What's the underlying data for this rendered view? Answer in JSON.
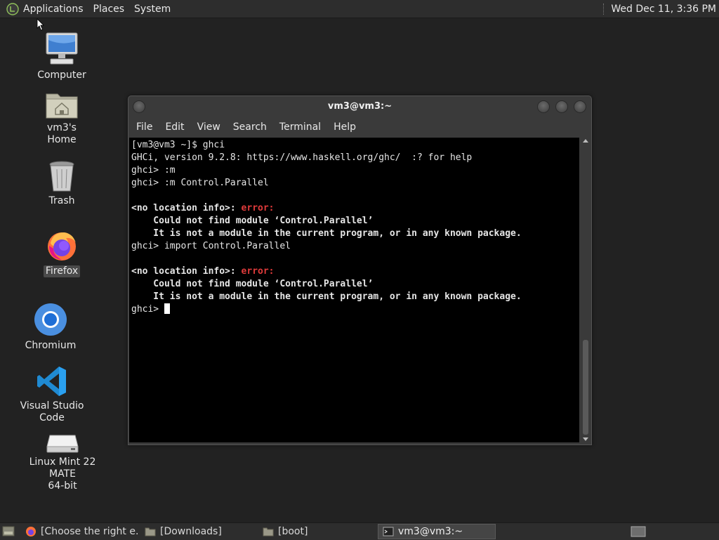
{
  "top_panel": {
    "menus": [
      "Applications",
      "Places",
      "System"
    ],
    "clock": "Wed Dec 11,  3:36 PM"
  },
  "desktop_icons": [
    {
      "label": "Computer",
      "icon": "computer-icon"
    },
    {
      "label": "vm3's Home",
      "icon": "home-folder-icon"
    },
    {
      "label": "Trash",
      "icon": "trash-icon"
    },
    {
      "label": "Firefox",
      "icon": "firefox-icon"
    },
    {
      "label": "Chromium",
      "icon": "chromium-icon"
    },
    {
      "label": "Visual Studio Code",
      "icon": "vscode-icon"
    },
    {
      "label": "Linux Mint 22 MATE",
      "label2": "64-bit",
      "icon": "drive-icon"
    }
  ],
  "terminal": {
    "title": "vm3@vm3:~",
    "menus": [
      "File",
      "Edit",
      "View",
      "Search",
      "Terminal",
      "Help"
    ],
    "lines": {
      "l1": "[vm3@vm3 ~]$ ghci",
      "l2": "GHCi, version 9.2.8: https://www.haskell.org/ghc/  :? for help",
      "l3": "ghci> :m",
      "l4": "ghci> :m Control.Parallel",
      "err1_prefix": "<no location info>: ",
      "err1_word": "error:",
      "err1_msg1": "    Could not find module ‘Control.Parallel’",
      "err1_msg2": "    It is not a module in the current program, or in any known package.",
      "l5": "ghci> import Control.Parallel",
      "err2_prefix": "<no location info>: ",
      "err2_word": "error:",
      "err2_msg1": "    Could not find module ‘Control.Parallel’",
      "err2_msg2": "    It is not a module in the current program, or in any known package.",
      "prompt": "ghci> "
    }
  },
  "taskbar": {
    "items": [
      "[Choose the right e...",
      "[Downloads]",
      "[boot]",
      "vm3@vm3:~"
    ],
    "active_index": 3
  },
  "colors": {
    "error": "#e03b3b",
    "terminal_bg": "#000000",
    "desktop_bg": "#222222"
  }
}
